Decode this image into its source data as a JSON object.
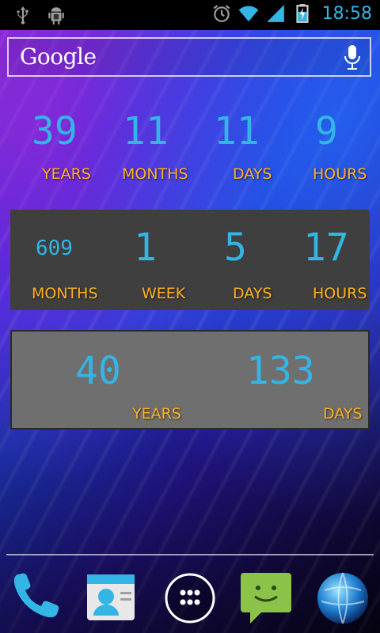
{
  "status_bar": {
    "time": "18:58",
    "left_icons": [
      "usb-icon",
      "android-debug-icon"
    ],
    "right_icons": [
      "alarm-icon",
      "wifi-icon",
      "signal-icon",
      "battery-charging-icon"
    ]
  },
  "search": {
    "brand": "Google",
    "mic_icon": "mic-icon"
  },
  "widget1": {
    "values": [
      "39",
      "11",
      "11",
      "9"
    ],
    "labels": [
      "YEARS",
      "MONTHS",
      "DAYS",
      "HOURS"
    ]
  },
  "widget2": {
    "values": [
      "609",
      "1",
      "5",
      "17"
    ],
    "labels": [
      "MONTHS",
      "WEEK",
      "DAYS",
      "HOURS"
    ]
  },
  "widget3": {
    "values": [
      "40",
      "133"
    ],
    "labels": [
      "YEARS",
      "DAYS"
    ]
  },
  "dock": {
    "items": [
      "phone-icon",
      "contacts-icon",
      "app-drawer-icon",
      "messaging-icon",
      "browser-icon"
    ]
  },
  "colors": {
    "number": "#33b5e5",
    "label": "#ffb01f"
  }
}
